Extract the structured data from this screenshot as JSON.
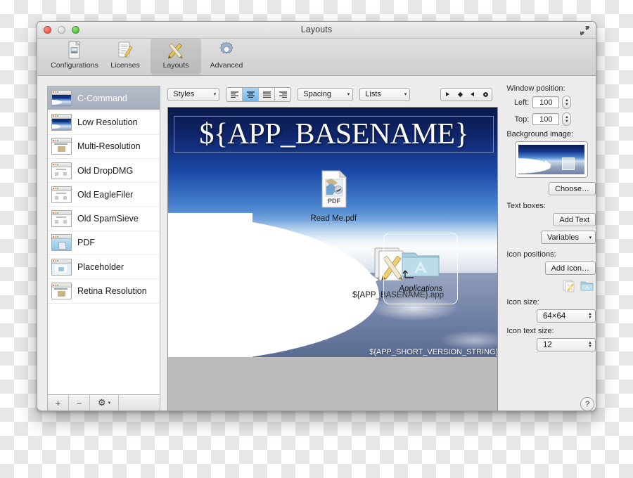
{
  "window": {
    "title": "Layouts",
    "traffic_lights": [
      "close-button",
      "minimize-button",
      "zoom-button"
    ],
    "fullscreen_icon": "fullscreen-arrows-icon"
  },
  "toolbar": {
    "items": [
      {
        "label": "Configurations",
        "icon": "document-stack-icon",
        "active": false
      },
      {
        "label": "Licenses",
        "icon": "document-pencil-icon",
        "active": false
      },
      {
        "label": "Layouts",
        "icon": "ruler-pencil-icon",
        "active": true
      },
      {
        "label": "Advanced",
        "icon": "gear-icon",
        "active": false
      }
    ]
  },
  "sidebar": {
    "items": [
      {
        "label": "C-Command",
        "selected": true
      },
      {
        "label": "Low Resolution",
        "selected": false
      },
      {
        "label": "Multi-Resolution",
        "selected": false
      },
      {
        "label": "Old DropDMG",
        "selected": false
      },
      {
        "label": "Old EagleFiler",
        "selected": false
      },
      {
        "label": "Old SpamSieve",
        "selected": false
      },
      {
        "label": "PDF",
        "selected": false
      },
      {
        "label": "Placeholder",
        "selected": false
      },
      {
        "label": "Retina Resolution",
        "selected": false
      }
    ],
    "footer": {
      "add_label": "+",
      "remove_label": "−",
      "gear_label": "⚙",
      "gear_caret": "▾"
    }
  },
  "format_bar": {
    "styles_label": "Styles",
    "spacing_label": "Spacing",
    "lists_label": "Lists",
    "caret": "▾",
    "alignment": {
      "buttons": [
        "align-left",
        "align-center",
        "align-right",
        "align-justify"
      ],
      "selected_index": 1
    },
    "nav_buttons": [
      "play-right-icon",
      "diamond-icon",
      "play-left-icon",
      "record-circle-icon"
    ]
  },
  "canvas": {
    "title_text": "${APP_BASENAME}",
    "version_text": "${APP_SHORT_VERSION_STRING}",
    "icons": [
      {
        "name": "readme-pdf",
        "label": "Read Me.pdf"
      },
      {
        "name": "app-bundle",
        "label": "${APP_BASENAME}.app"
      },
      {
        "name": "applications-folder",
        "label": "Applications",
        "selected": true
      }
    ]
  },
  "right_panel": {
    "window_position_label": "Window position:",
    "left_label": "Left:",
    "left_value": "100",
    "top_label": "Top:",
    "top_value": "100",
    "background_image_label": "Background image:",
    "choose_label": "Choose…",
    "text_boxes_label": "Text boxes:",
    "add_text_label": "Add Text",
    "variables_label": "Variables",
    "icon_positions_label": "Icon positions:",
    "add_icon_label": "Add Icon…",
    "icon_size_label": "Icon size:",
    "icon_size_value": "64×64",
    "icon_text_size_label": "Icon text size:",
    "icon_text_size_value": "12",
    "help_label": "?",
    "caret": "▾",
    "stepper_up": "▲",
    "stepper_down": "▼"
  },
  "colors": {
    "selection_blue": "#6fb6ef",
    "sidebar_selection": "#a7afbd",
    "banner_navy": "#0f2566",
    "toolbar_gray": "#d4d4d4"
  }
}
